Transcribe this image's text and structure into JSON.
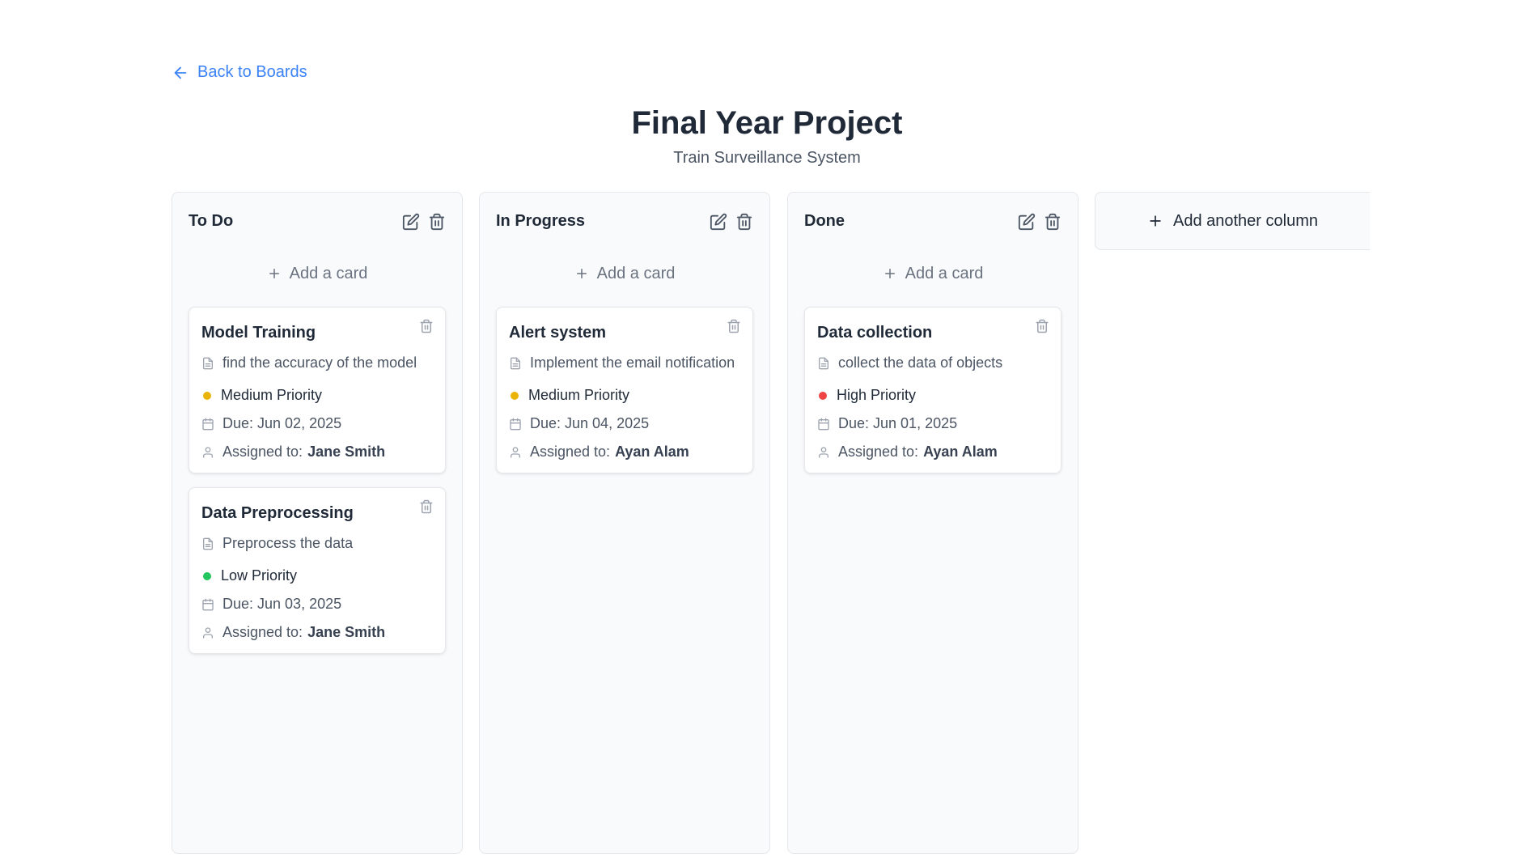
{
  "nav": {
    "back_label": "Back to Boards"
  },
  "board": {
    "title": "Final Year Project",
    "subtitle": "Train Surveillance System"
  },
  "add_card_label": "Add a card",
  "add_column_label": "Add another column",
  "priority_colors": {
    "Medium": "#eab308",
    "Low": "#22c55e",
    "High": "#ef4444"
  },
  "columns": [
    {
      "title": "To Do",
      "cards": [
        {
          "title": "Model Training",
          "description": "find the accuracy of the model",
          "priority": "Medium Priority",
          "due": "Due: Jun 02, 2025",
          "assigned_label": "Assigned to:",
          "assignee": "Jane Smith"
        },
        {
          "title": "Data Preprocessing",
          "description": "Preprocess the data",
          "priority": "Low Priority",
          "due": "Due: Jun 03, 2025",
          "assigned_label": "Assigned to:",
          "assignee": "Jane Smith"
        }
      ]
    },
    {
      "title": "In Progress",
      "cards": [
        {
          "title": "Alert system",
          "description": "Implement the email notification",
          "priority": "Medium Priority",
          "due": "Due: Jun 04, 2025",
          "assigned_label": "Assigned to:",
          "assignee": "Ayan Alam"
        }
      ]
    },
    {
      "title": "Done",
      "cards": [
        {
          "title": "Data collection",
          "description": "collect the data of objects",
          "priority": "High Priority",
          "due": "Due: Jun 01, 2025",
          "assigned_label": "Assigned to:",
          "assignee": "Ayan Alam"
        }
      ]
    }
  ],
  "icons": {
    "back": "arrow-left-icon",
    "edit": "edit-icon",
    "delete": "trash-icon",
    "add": "plus-icon",
    "description": "document-icon",
    "due": "calendar-icon",
    "assignee": "user-icon"
  }
}
